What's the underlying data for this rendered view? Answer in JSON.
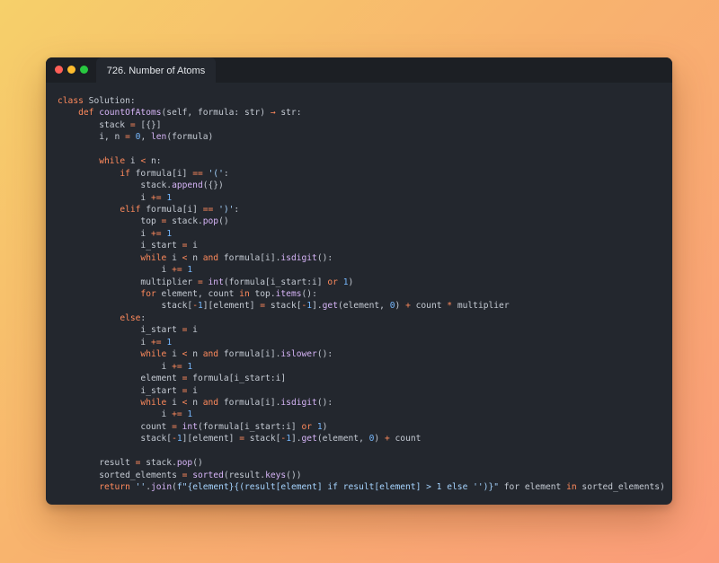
{
  "window": {
    "tab_title": "726. Number of Atoms"
  },
  "editor": {
    "language": "python",
    "lines": [
      [
        [
          "kw",
          "class"
        ],
        [
          "plain",
          " Solution:"
        ]
      ],
      [
        [
          "plain",
          "    "
        ],
        [
          "kw",
          "def"
        ],
        [
          "plain",
          " "
        ],
        [
          "fn",
          "countOfAtoms"
        ],
        [
          "plain",
          "(self, formula: str) "
        ],
        [
          "op",
          "→"
        ],
        [
          "plain",
          " str:"
        ]
      ],
      [
        [
          "plain",
          "        stack "
        ],
        [
          "op",
          "="
        ],
        [
          "plain",
          " [{}]"
        ]
      ],
      [
        [
          "plain",
          "        i, n "
        ],
        [
          "op",
          "="
        ],
        [
          "plain",
          " "
        ],
        [
          "num",
          "0"
        ],
        [
          "plain",
          ", "
        ],
        [
          "fn",
          "len"
        ],
        [
          "plain",
          "(formula)"
        ]
      ],
      [
        [
          "plain",
          ""
        ]
      ],
      [
        [
          "plain",
          "        "
        ],
        [
          "kw",
          "while"
        ],
        [
          "plain",
          " i "
        ],
        [
          "op",
          "<"
        ],
        [
          "plain",
          " n:"
        ]
      ],
      [
        [
          "plain",
          "            "
        ],
        [
          "kw",
          "if"
        ],
        [
          "plain",
          " formula[i] "
        ],
        [
          "op",
          "=="
        ],
        [
          "plain",
          " "
        ],
        [
          "str",
          "'('"
        ],
        [
          "plain",
          ":"
        ]
      ],
      [
        [
          "plain",
          "                stack."
        ],
        [
          "fn",
          "append"
        ],
        [
          "plain",
          "({})"
        ]
      ],
      [
        [
          "plain",
          "                i "
        ],
        [
          "op",
          "+="
        ],
        [
          "plain",
          " "
        ],
        [
          "num",
          "1"
        ]
      ],
      [
        [
          "plain",
          "            "
        ],
        [
          "kw",
          "elif"
        ],
        [
          "plain",
          " formula[i] "
        ],
        [
          "op",
          "=="
        ],
        [
          "plain",
          " "
        ],
        [
          "str",
          "')'"
        ],
        [
          "plain",
          ":"
        ]
      ],
      [
        [
          "plain",
          "                top "
        ],
        [
          "op",
          "="
        ],
        [
          "plain",
          " stack."
        ],
        [
          "fn",
          "pop"
        ],
        [
          "plain",
          "()"
        ]
      ],
      [
        [
          "plain",
          "                i "
        ],
        [
          "op",
          "+="
        ],
        [
          "plain",
          " "
        ],
        [
          "num",
          "1"
        ]
      ],
      [
        [
          "plain",
          "                i_start "
        ],
        [
          "op",
          "="
        ],
        [
          "plain",
          " i"
        ]
      ],
      [
        [
          "plain",
          "                "
        ],
        [
          "kw",
          "while"
        ],
        [
          "plain",
          " i "
        ],
        [
          "op",
          "<"
        ],
        [
          "plain",
          " n "
        ],
        [
          "kw",
          "and"
        ],
        [
          "plain",
          " formula[i]."
        ],
        [
          "fn",
          "isdigit"
        ],
        [
          "plain",
          "():"
        ]
      ],
      [
        [
          "plain",
          "                    i "
        ],
        [
          "op",
          "+="
        ],
        [
          "plain",
          " "
        ],
        [
          "num",
          "1"
        ]
      ],
      [
        [
          "plain",
          "                multiplier "
        ],
        [
          "op",
          "="
        ],
        [
          "plain",
          " "
        ],
        [
          "fn",
          "int"
        ],
        [
          "plain",
          "(formula[i_start:i] "
        ],
        [
          "kw",
          "or"
        ],
        [
          "plain",
          " "
        ],
        [
          "num",
          "1"
        ],
        [
          "plain",
          ")"
        ]
      ],
      [
        [
          "plain",
          "                "
        ],
        [
          "kw",
          "for"
        ],
        [
          "plain",
          " element, count "
        ],
        [
          "kw",
          "in"
        ],
        [
          "plain",
          " top."
        ],
        [
          "fn",
          "items"
        ],
        [
          "plain",
          "():"
        ]
      ],
      [
        [
          "plain",
          "                    stack["
        ],
        [
          "op",
          "-"
        ],
        [
          "num",
          "1"
        ],
        [
          "plain",
          "][element] "
        ],
        [
          "op",
          "="
        ],
        [
          "plain",
          " stack["
        ],
        [
          "op",
          "-"
        ],
        [
          "num",
          "1"
        ],
        [
          "plain",
          "]."
        ],
        [
          "fn",
          "get"
        ],
        [
          "plain",
          "(element, "
        ],
        [
          "num",
          "0"
        ],
        [
          "plain",
          ") "
        ],
        [
          "op",
          "+"
        ],
        [
          "plain",
          " count "
        ],
        [
          "op",
          "*"
        ],
        [
          "plain",
          " multiplier"
        ]
      ],
      [
        [
          "plain",
          "            "
        ],
        [
          "kw",
          "else"
        ],
        [
          "plain",
          ":"
        ]
      ],
      [
        [
          "plain",
          "                i_start "
        ],
        [
          "op",
          "="
        ],
        [
          "plain",
          " i"
        ]
      ],
      [
        [
          "plain",
          "                i "
        ],
        [
          "op",
          "+="
        ],
        [
          "plain",
          " "
        ],
        [
          "num",
          "1"
        ]
      ],
      [
        [
          "plain",
          "                "
        ],
        [
          "kw",
          "while"
        ],
        [
          "plain",
          " i "
        ],
        [
          "op",
          "<"
        ],
        [
          "plain",
          " n "
        ],
        [
          "kw",
          "and"
        ],
        [
          "plain",
          " formula[i]."
        ],
        [
          "fn",
          "islower"
        ],
        [
          "plain",
          "():"
        ]
      ],
      [
        [
          "plain",
          "                    i "
        ],
        [
          "op",
          "+="
        ],
        [
          "plain",
          " "
        ],
        [
          "num",
          "1"
        ]
      ],
      [
        [
          "plain",
          "                element "
        ],
        [
          "op",
          "="
        ],
        [
          "plain",
          " formula[i_start:i]"
        ]
      ],
      [
        [
          "plain",
          "                i_start "
        ],
        [
          "op",
          "="
        ],
        [
          "plain",
          " i"
        ]
      ],
      [
        [
          "plain",
          "                "
        ],
        [
          "kw",
          "while"
        ],
        [
          "plain",
          " i "
        ],
        [
          "op",
          "<"
        ],
        [
          "plain",
          " n "
        ],
        [
          "kw",
          "and"
        ],
        [
          "plain",
          " formula[i]."
        ],
        [
          "fn",
          "isdigit"
        ],
        [
          "plain",
          "():"
        ]
      ],
      [
        [
          "plain",
          "                    i "
        ],
        [
          "op",
          "+="
        ],
        [
          "plain",
          " "
        ],
        [
          "num",
          "1"
        ]
      ],
      [
        [
          "plain",
          "                count "
        ],
        [
          "op",
          "="
        ],
        [
          "plain",
          " "
        ],
        [
          "fn",
          "int"
        ],
        [
          "plain",
          "(formula[i_start:i] "
        ],
        [
          "kw",
          "or"
        ],
        [
          "plain",
          " "
        ],
        [
          "num",
          "1"
        ],
        [
          "plain",
          ")"
        ]
      ],
      [
        [
          "plain",
          "                stack["
        ],
        [
          "op",
          "-"
        ],
        [
          "num",
          "1"
        ],
        [
          "plain",
          "][element] "
        ],
        [
          "op",
          "="
        ],
        [
          "plain",
          " stack["
        ],
        [
          "op",
          "-"
        ],
        [
          "num",
          "1"
        ],
        [
          "plain",
          "]."
        ],
        [
          "fn",
          "get"
        ],
        [
          "plain",
          "(element, "
        ],
        [
          "num",
          "0"
        ],
        [
          "plain",
          ") "
        ],
        [
          "op",
          "+"
        ],
        [
          "plain",
          " count"
        ]
      ],
      [
        [
          "plain",
          ""
        ]
      ],
      [
        [
          "plain",
          "        result "
        ],
        [
          "op",
          "="
        ],
        [
          "plain",
          " stack."
        ],
        [
          "fn",
          "pop"
        ],
        [
          "plain",
          "()"
        ]
      ],
      [
        [
          "plain",
          "        sorted_elements "
        ],
        [
          "op",
          "="
        ],
        [
          "plain",
          " "
        ],
        [
          "fn",
          "sorted"
        ],
        [
          "plain",
          "(result."
        ],
        [
          "fn",
          "keys"
        ],
        [
          "plain",
          "())"
        ]
      ],
      [
        [
          "plain",
          "        "
        ],
        [
          "kw",
          "return"
        ],
        [
          "plain",
          " "
        ],
        [
          "str",
          "''"
        ],
        [
          "plain",
          "."
        ],
        [
          "fn",
          "join"
        ],
        [
          "plain",
          "("
        ],
        [
          "str",
          "f\"{element}{(result[element] if result[element] > 1 else '')}\""
        ],
        [
          "plain",
          " for element "
        ],
        [
          "kw",
          "in"
        ],
        [
          "plain",
          " sorted_elements)"
        ]
      ]
    ]
  }
}
